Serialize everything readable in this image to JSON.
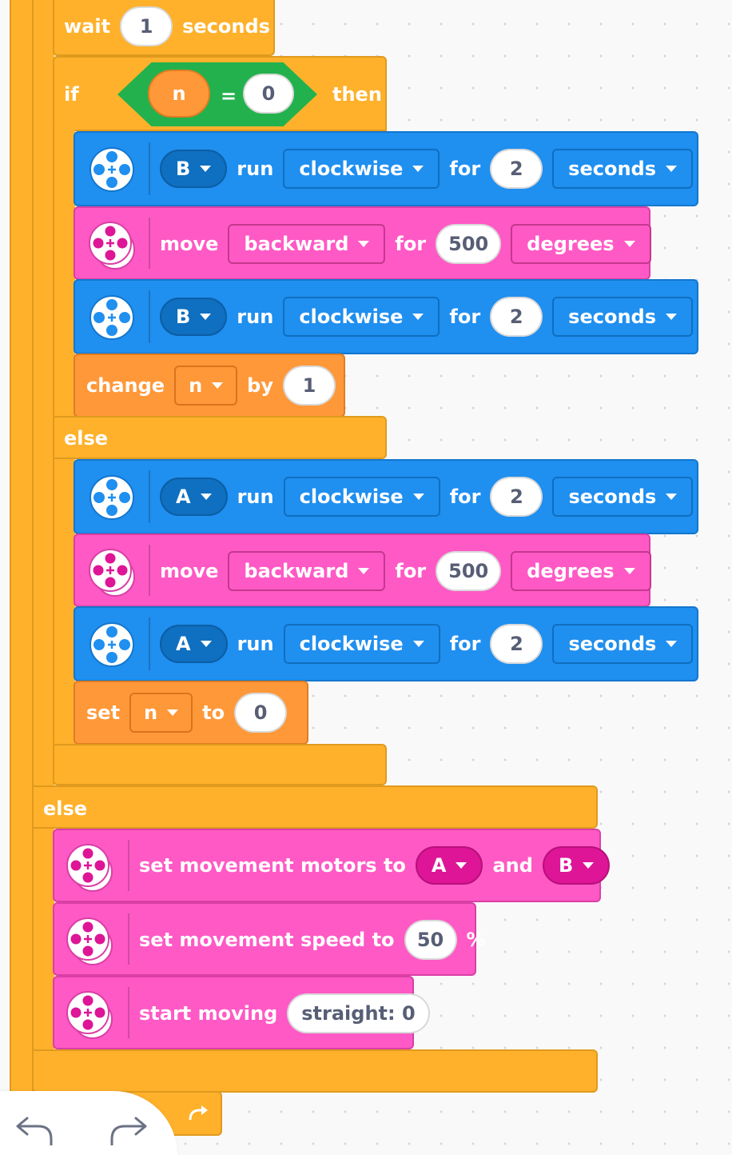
{
  "wait": {
    "label": "wait",
    "value": "1",
    "unit": "seconds"
  },
  "if_block": {
    "label": "if",
    "then": "then",
    "condition": {
      "var": "n",
      "op": "=",
      "value": "0"
    }
  },
  "inner_if": [
    {
      "port": "B",
      "run": "run",
      "direction": "clockwise",
      "for": "for",
      "value": "2",
      "unit": "seconds"
    },
    {
      "move": "move",
      "direction": "backward",
      "for": "for",
      "value": "500",
      "unit": "degrees"
    },
    {
      "port": "B",
      "run": "run",
      "direction": "clockwise",
      "for": "for",
      "value": "2",
      "unit": "seconds"
    }
  ],
  "change": {
    "label": "change",
    "var": "n",
    "by": "by",
    "value": "1"
  },
  "else_inner": "else",
  "inner_else": [
    {
      "port": "A",
      "run": "run",
      "direction": "clockwise",
      "for": "for",
      "value": "2",
      "unit": "seconds"
    },
    {
      "move": "move",
      "direction": "backward",
      "for": "for",
      "value": "500",
      "unit": "degrees"
    },
    {
      "port": "A",
      "run": "run",
      "direction": "clockwise",
      "for": "for",
      "value": "2",
      "unit": "seconds"
    }
  ],
  "set_var": {
    "label": "set",
    "var": "n",
    "to": "to",
    "value": "0"
  },
  "else_outer": "else",
  "movement": {
    "motors": {
      "label": "set movement motors to",
      "a": "A",
      "and": "and",
      "b": "B"
    },
    "speed": {
      "label": "set movement speed to",
      "value": "50",
      "unit": "%"
    },
    "start": {
      "label": "start moving",
      "value": "straight: 0"
    }
  },
  "colors": {
    "control": "#ffb12b",
    "motor": "#1f8ff0",
    "movement": "#ff59c5",
    "variable": "#ff9838",
    "operator": "#23b14d"
  }
}
